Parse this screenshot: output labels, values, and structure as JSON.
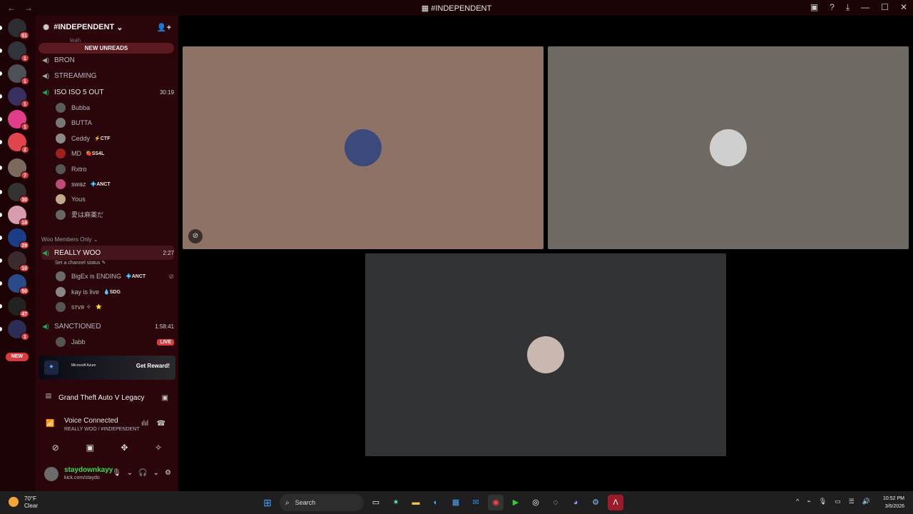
{
  "window": {
    "title": "#INDEPENDENT",
    "back": "←",
    "forward": "→"
  },
  "servers": {
    "items": [
      {
        "badge": "51",
        "color": "#2b2d31"
      },
      {
        "badge": "1",
        "color": "#31343d"
      },
      {
        "badge": "1",
        "color": "#4e5058"
      },
      {
        "badge": "1",
        "color": "#3a3060"
      },
      {
        "badge": "1",
        "color": "#e03e8a"
      },
      {
        "badge": "2",
        "color": "#e0454d"
      },
      {
        "badge": "7",
        "color": "#7b6a5c"
      },
      {
        "badge": "30",
        "color": "#333"
      },
      {
        "badge": "18",
        "color": "#d89bb0"
      },
      {
        "badge": "29",
        "color": "#1b3c86"
      },
      {
        "badge": "10",
        "color": "#3a2b30"
      },
      {
        "badge": "50",
        "color": "#2a4a8a"
      },
      {
        "badge": "47",
        "color": "#222"
      },
      {
        "badge": "1",
        "color": "#2b2d55"
      }
    ],
    "new_label": "NEW"
  },
  "guild": {
    "name": "#INDEPENDENT",
    "new_unreads": "NEW UNREADS",
    "partial_top": "leah"
  },
  "channels": [
    {
      "name": "BRON",
      "time": "",
      "connected": false
    },
    {
      "name": "STREAMING",
      "time": "",
      "connected": false
    },
    {
      "name": "ISO ISO 5 OUT",
      "time": "30:19",
      "connected": true
    }
  ],
  "iso_members": [
    {
      "name": "Bubba",
      "tag": "",
      "color": "#5c5c5c"
    },
    {
      "name": "BUTTA",
      "tag": "",
      "color": "#777"
    },
    {
      "name": "Ceddy",
      "tag": "⚡CTF",
      "color": "#8a8a8a"
    },
    {
      "name": "MD",
      "tag": "🍓SS4L",
      "color": "#a02020"
    },
    {
      "name": "Rxtro",
      "tag": "",
      "color": "#555"
    },
    {
      "name": "swaz",
      "tag": "💠ANCT",
      "color": "#c04a7a"
    },
    {
      "name": "Yous",
      "tag": "",
      "color": "#bfa98a"
    },
    {
      "name": "愛は麻薬だ",
      "tag": "",
      "color": "#666"
    }
  ],
  "category": "Woo Members Only ⌄",
  "really_woo": {
    "name": "REALLY WOO",
    "time": "2:27",
    "status": "Set a channel status ✎",
    "members": [
      {
        "name": "BigEx is ENDING",
        "tag": "💠ANCT",
        "color": "#6a6a6a"
      },
      {
        "name": "kay is live",
        "tag": "💧SDG",
        "color": "#888"
      },
      {
        "name": "sтvя ✧",
        "tag": "⭐",
        "color": "#555"
      }
    ]
  },
  "sanctioned": {
    "name": "SANCTIONED",
    "time": "1:58:41",
    "member": "Jabb",
    "live": "LIVE"
  },
  "promo": {
    "brand": "Microsoft Azure",
    "reward": "Get Reward!"
  },
  "activity": {
    "game": "Grand Theft Auto V Legacy"
  },
  "voice": {
    "status": "Voice Connected",
    "channel": "REALLY WOO / #INDEPENDENT"
  },
  "user": {
    "name": "staydownkayy",
    "sub": "kick.com/staydo"
  },
  "tiles": [
    {
      "bg": "#8e7265",
      "avatar": "#3b4a7a"
    },
    {
      "bg": "#6e6962",
      "avatar": "#cfcfcf"
    },
    {
      "bg": "#313335",
      "avatar": "#c9b8b0"
    }
  ],
  "taskbar": {
    "temp": "70°F",
    "condition": "Clear",
    "search": "Search",
    "time": "10:52 PM",
    "date": "3/6/2026"
  },
  "colors": {
    "accent_red": "#d83c3e",
    "connected_green": "#23a559",
    "username_green": "#3ddc55"
  }
}
